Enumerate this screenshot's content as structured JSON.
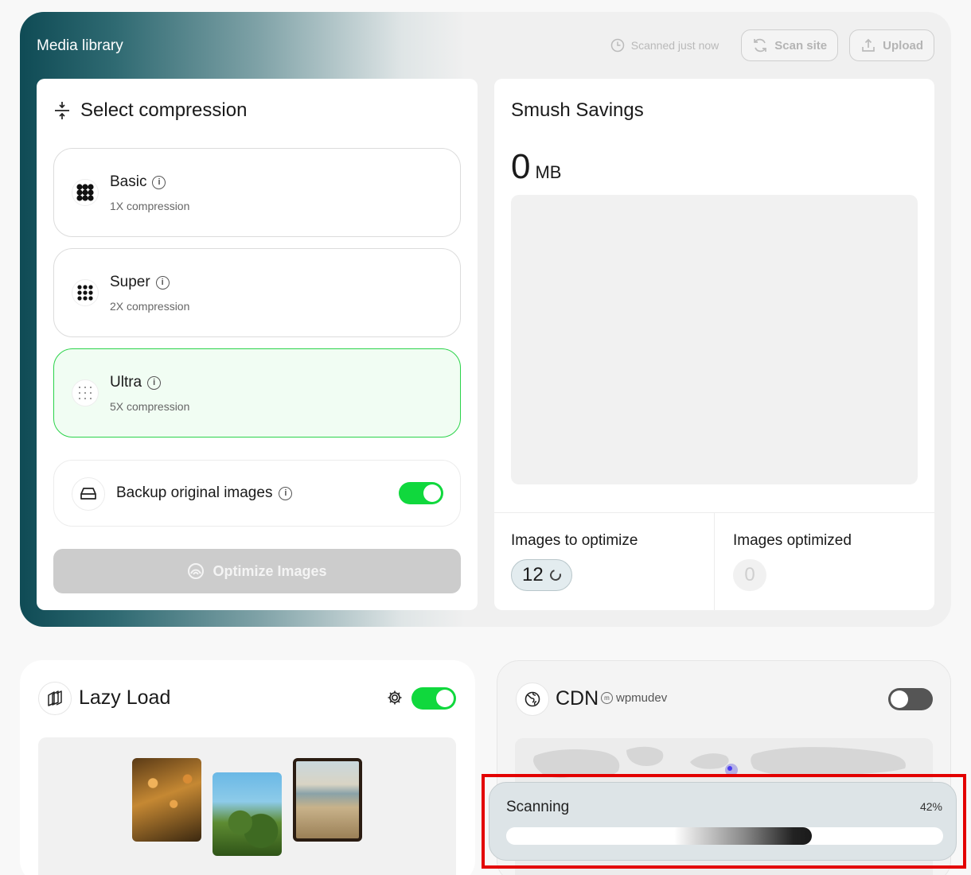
{
  "media_library": {
    "title": "Media library",
    "scanned_text": "Scanned just now",
    "scan_button": "Scan site",
    "upload_button": "Upload"
  },
  "compression": {
    "heading": "Select compression",
    "options": [
      {
        "name": "Basic",
        "subtitle": "1X compression",
        "selected": false
      },
      {
        "name": "Super",
        "subtitle": "2X compression",
        "selected": false
      },
      {
        "name": "Ultra",
        "subtitle": "5X compression",
        "selected": true
      }
    ],
    "backup_label": "Backup original images",
    "backup_enabled": true,
    "optimize_button": "Optimize Images"
  },
  "savings": {
    "title": "Smush Savings",
    "value": "0",
    "unit": "MB",
    "images_to_optimize_label": "Images to optimize",
    "images_to_optimize": "12",
    "images_optimized_label": "Images optimized",
    "images_optimized": "0"
  },
  "lazy_load": {
    "title": "Lazy Load",
    "enabled": true
  },
  "cdn": {
    "title": "CDN",
    "handle": "wpmudev",
    "enabled": false
  },
  "scanning": {
    "label": "Scanning",
    "percent_text": "42%",
    "progress": 0.7
  },
  "colors": {
    "accent_green": "#10d83d",
    "hero_teal": "#0f4b55",
    "highlight_red": "#e30000"
  }
}
